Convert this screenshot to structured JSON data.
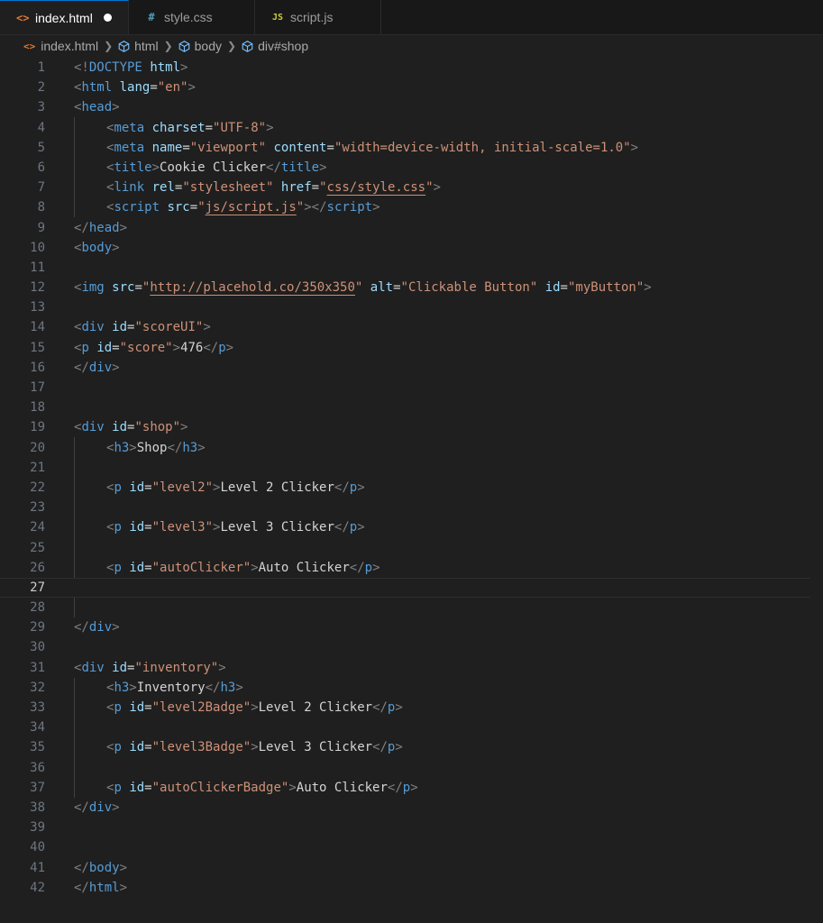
{
  "tabs": [
    {
      "icon": "<>",
      "label": "index.html",
      "active": true,
      "modified": true,
      "icon_color": "#e37933"
    },
    {
      "icon": "#",
      "label": "style.css",
      "active": false,
      "modified": false,
      "icon_color": "#519aba"
    },
    {
      "icon": "JS",
      "label": "script.js",
      "active": false,
      "modified": false,
      "icon_color": "#cbcb41"
    }
  ],
  "breadcrumb": {
    "file": "index.html",
    "items": [
      "html",
      "body",
      "div#shop"
    ]
  },
  "editor": {
    "current_line": 27,
    "lines": [
      {
        "n": "1",
        "indent": 0,
        "tokens": [
          [
            "br",
            "<!"
          ],
          [
            "tag",
            "DOCTYPE"
          ],
          [
            "txt",
            " "
          ],
          [
            "attr",
            "html"
          ],
          [
            "br",
            ">"
          ]
        ]
      },
      {
        "n": "2",
        "indent": 0,
        "tokens": [
          [
            "br",
            "<"
          ],
          [
            "tag",
            "html"
          ],
          [
            "txt",
            " "
          ],
          [
            "attr",
            "lang"
          ],
          [
            "txt",
            "="
          ],
          [
            "str",
            "\"en\""
          ],
          [
            "br",
            ">"
          ]
        ]
      },
      {
        "n": "3",
        "indent": 0,
        "tokens": [
          [
            "br",
            "<"
          ],
          [
            "tag",
            "head"
          ],
          [
            "br",
            ">"
          ]
        ]
      },
      {
        "n": "4",
        "indent": 1,
        "tokens": [
          [
            "br",
            "<"
          ],
          [
            "tag",
            "meta"
          ],
          [
            "txt",
            " "
          ],
          [
            "attr",
            "charset"
          ],
          [
            "txt",
            "="
          ],
          [
            "str",
            "\"UTF-8\""
          ],
          [
            "br",
            ">"
          ]
        ]
      },
      {
        "n": "5",
        "indent": 1,
        "tokens": [
          [
            "br",
            "<"
          ],
          [
            "tag",
            "meta"
          ],
          [
            "txt",
            " "
          ],
          [
            "attr",
            "name"
          ],
          [
            "txt",
            "="
          ],
          [
            "str",
            "\"viewport\""
          ],
          [
            "txt",
            " "
          ],
          [
            "attr",
            "content"
          ],
          [
            "txt",
            "="
          ],
          [
            "str",
            "\"width=device-width, initial-scale=1.0\""
          ],
          [
            "br",
            ">"
          ]
        ]
      },
      {
        "n": "6",
        "indent": 1,
        "tokens": [
          [
            "br",
            "<"
          ],
          [
            "tag",
            "title"
          ],
          [
            "br",
            ">"
          ],
          [
            "txt",
            "Cookie Clicker"
          ],
          [
            "br",
            "</"
          ],
          [
            "tag",
            "title"
          ],
          [
            "br",
            ">"
          ]
        ]
      },
      {
        "n": "7",
        "indent": 1,
        "tokens": [
          [
            "br",
            "<"
          ],
          [
            "tag",
            "link"
          ],
          [
            "txt",
            " "
          ],
          [
            "attr",
            "rel"
          ],
          [
            "txt",
            "="
          ],
          [
            "str",
            "\"stylesheet\""
          ],
          [
            "txt",
            " "
          ],
          [
            "attr",
            "href"
          ],
          [
            "txt",
            "="
          ],
          [
            "str",
            "\""
          ],
          [
            "link",
            "css/style.css"
          ],
          [
            "str",
            "\""
          ],
          [
            "br",
            ">"
          ]
        ]
      },
      {
        "n": "8",
        "indent": 1,
        "tokens": [
          [
            "br",
            "<"
          ],
          [
            "tag",
            "script"
          ],
          [
            "txt",
            " "
          ],
          [
            "attr",
            "src"
          ],
          [
            "txt",
            "="
          ],
          [
            "str",
            "\""
          ],
          [
            "link",
            "js/script.js"
          ],
          [
            "str",
            "\""
          ],
          [
            "br",
            "></"
          ],
          [
            "tag",
            "script"
          ],
          [
            "br",
            ">"
          ]
        ]
      },
      {
        "n": "9",
        "indent": 0,
        "tokens": [
          [
            "br",
            "</"
          ],
          [
            "tag",
            "head"
          ],
          [
            "br",
            ">"
          ]
        ]
      },
      {
        "n": "10",
        "indent": 0,
        "tokens": [
          [
            "br",
            "<"
          ],
          [
            "tag",
            "body"
          ],
          [
            "br",
            ">"
          ]
        ]
      },
      {
        "n": "11",
        "indent": 0,
        "tokens": []
      },
      {
        "n": "12",
        "indent": 0,
        "tokens": [
          [
            "br",
            "<"
          ],
          [
            "tag",
            "img"
          ],
          [
            "txt",
            " "
          ],
          [
            "attr",
            "src"
          ],
          [
            "txt",
            "="
          ],
          [
            "str",
            "\""
          ],
          [
            "link",
            "http://placehold.co/350x350"
          ],
          [
            "str",
            "\""
          ],
          [
            "txt",
            " "
          ],
          [
            "attr",
            "alt"
          ],
          [
            "txt",
            "="
          ],
          [
            "str",
            "\"Clickable Button\""
          ],
          [
            "txt",
            " "
          ],
          [
            "attr",
            "id"
          ],
          [
            "txt",
            "="
          ],
          [
            "str",
            "\"myButton\""
          ],
          [
            "br",
            ">"
          ]
        ]
      },
      {
        "n": "13",
        "indent": 0,
        "tokens": []
      },
      {
        "n": "14",
        "indent": 0,
        "tokens": [
          [
            "br",
            "<"
          ],
          [
            "tag",
            "div"
          ],
          [
            "txt",
            " "
          ],
          [
            "attr",
            "id"
          ],
          [
            "txt",
            "="
          ],
          [
            "str",
            "\"scoreUI\""
          ],
          [
            "br",
            ">"
          ]
        ]
      },
      {
        "n": "15",
        "indent": 0,
        "tokens": [
          [
            "br",
            "<"
          ],
          [
            "tag",
            "p"
          ],
          [
            "txt",
            " "
          ],
          [
            "attr",
            "id"
          ],
          [
            "txt",
            "="
          ],
          [
            "str",
            "\"score\""
          ],
          [
            "br",
            ">"
          ],
          [
            "txt",
            "476"
          ],
          [
            "br",
            "</"
          ],
          [
            "tag",
            "p"
          ],
          [
            "br",
            ">"
          ]
        ]
      },
      {
        "n": "16",
        "indent": 0,
        "tokens": [
          [
            "br",
            "</"
          ],
          [
            "tag",
            "div"
          ],
          [
            "br",
            ">"
          ]
        ]
      },
      {
        "n": "17",
        "indent": 0,
        "tokens": []
      },
      {
        "n": "18",
        "indent": 0,
        "tokens": []
      },
      {
        "n": "19",
        "indent": 0,
        "tokens": [
          [
            "br",
            "<"
          ],
          [
            "tag",
            "div"
          ],
          [
            "txt",
            " "
          ],
          [
            "attr",
            "id"
          ],
          [
            "txt",
            "="
          ],
          [
            "str",
            "\"shop\""
          ],
          [
            "br",
            ">"
          ]
        ]
      },
      {
        "n": "20",
        "indent": 1,
        "tokens": [
          [
            "br",
            "<"
          ],
          [
            "tag",
            "h3"
          ],
          [
            "br",
            ">"
          ],
          [
            "txt",
            "Shop"
          ],
          [
            "br",
            "</"
          ],
          [
            "tag",
            "h3"
          ],
          [
            "br",
            ">"
          ]
        ]
      },
      {
        "n": "21",
        "indent": 0,
        "tokens": []
      },
      {
        "n": "22",
        "indent": 1,
        "tokens": [
          [
            "br",
            "<"
          ],
          [
            "tag",
            "p"
          ],
          [
            "txt",
            " "
          ],
          [
            "attr",
            "id"
          ],
          [
            "txt",
            "="
          ],
          [
            "str",
            "\"level2\""
          ],
          [
            "br",
            ">"
          ],
          [
            "txt",
            "Level 2 Clicker"
          ],
          [
            "br",
            "</"
          ],
          [
            "tag",
            "p"
          ],
          [
            "br",
            ">"
          ]
        ]
      },
      {
        "n": "23",
        "indent": 0,
        "tokens": []
      },
      {
        "n": "24",
        "indent": 1,
        "tokens": [
          [
            "br",
            "<"
          ],
          [
            "tag",
            "p"
          ],
          [
            "txt",
            " "
          ],
          [
            "attr",
            "id"
          ],
          [
            "txt",
            "="
          ],
          [
            "str",
            "\"level3\""
          ],
          [
            "br",
            ">"
          ],
          [
            "txt",
            "Level 3 Clicker"
          ],
          [
            "br",
            "</"
          ],
          [
            "tag",
            "p"
          ],
          [
            "br",
            ">"
          ]
        ]
      },
      {
        "n": "25",
        "indent": 0,
        "tokens": []
      },
      {
        "n": "26",
        "indent": 1,
        "tokens": [
          [
            "br",
            "<"
          ],
          [
            "tag",
            "p"
          ],
          [
            "txt",
            " "
          ],
          [
            "attr",
            "id"
          ],
          [
            "txt",
            "="
          ],
          [
            "str",
            "\"autoClicker\""
          ],
          [
            "br",
            ">"
          ],
          [
            "txt",
            "Auto Clicker"
          ],
          [
            "br",
            "</"
          ],
          [
            "tag",
            "p"
          ],
          [
            "br",
            ">"
          ]
        ]
      },
      {
        "n": "27",
        "indent": 0,
        "tokens": []
      },
      {
        "n": "28",
        "indent": 0,
        "tokens": []
      },
      {
        "n": "29",
        "indent": 0,
        "tokens": [
          [
            "br",
            "</"
          ],
          [
            "tag",
            "div"
          ],
          [
            "br",
            ">"
          ]
        ]
      },
      {
        "n": "30",
        "indent": 0,
        "tokens": []
      },
      {
        "n": "31",
        "indent": 0,
        "tokens": [
          [
            "br",
            "<"
          ],
          [
            "tag",
            "div"
          ],
          [
            "txt",
            " "
          ],
          [
            "attr",
            "id"
          ],
          [
            "txt",
            "="
          ],
          [
            "str",
            "\"inventory\""
          ],
          [
            "br",
            ">"
          ]
        ]
      },
      {
        "n": "32",
        "indent": 1,
        "tokens": [
          [
            "br",
            "<"
          ],
          [
            "tag",
            "h3"
          ],
          [
            "br",
            ">"
          ],
          [
            "txt",
            "Inventory"
          ],
          [
            "br",
            "</"
          ],
          [
            "tag",
            "h3"
          ],
          [
            "br",
            ">"
          ]
        ]
      },
      {
        "n": "33",
        "indent": 1,
        "tokens": [
          [
            "br",
            "<"
          ],
          [
            "tag",
            "p"
          ],
          [
            "txt",
            " "
          ],
          [
            "attr",
            "id"
          ],
          [
            "txt",
            "="
          ],
          [
            "str",
            "\"level2Badge\""
          ],
          [
            "br",
            ">"
          ],
          [
            "txt",
            "Level 2 Clicker"
          ],
          [
            "br",
            "</"
          ],
          [
            "tag",
            "p"
          ],
          [
            "br",
            ">"
          ]
        ]
      },
      {
        "n": "34",
        "indent": 0,
        "tokens": []
      },
      {
        "n": "35",
        "indent": 1,
        "tokens": [
          [
            "br",
            "<"
          ],
          [
            "tag",
            "p"
          ],
          [
            "txt",
            " "
          ],
          [
            "attr",
            "id"
          ],
          [
            "txt",
            "="
          ],
          [
            "str",
            "\"level3Badge\""
          ],
          [
            "br",
            ">"
          ],
          [
            "txt",
            "Level 3 Clicker"
          ],
          [
            "br",
            "</"
          ],
          [
            "tag",
            "p"
          ],
          [
            "br",
            ">"
          ]
        ]
      },
      {
        "n": "36",
        "indent": 0,
        "tokens": []
      },
      {
        "n": "37",
        "indent": 1,
        "tokens": [
          [
            "br",
            "<"
          ],
          [
            "tag",
            "p"
          ],
          [
            "txt",
            " "
          ],
          [
            "attr",
            "id"
          ],
          [
            "txt",
            "="
          ],
          [
            "str",
            "\"autoClickerBadge\""
          ],
          [
            "br",
            ">"
          ],
          [
            "txt",
            "Auto Clicker"
          ],
          [
            "br",
            "</"
          ],
          [
            "tag",
            "p"
          ],
          [
            "br",
            ">"
          ]
        ]
      },
      {
        "n": "38",
        "indent": 0,
        "tokens": [
          [
            "br",
            "</"
          ],
          [
            "tag",
            "div"
          ],
          [
            "br",
            ">"
          ]
        ]
      },
      {
        "n": "39",
        "indent": 0,
        "tokens": []
      },
      {
        "n": "40",
        "indent": 0,
        "tokens": []
      },
      {
        "n": "41",
        "indent": 0,
        "tokens": [
          [
            "br",
            "</"
          ],
          [
            "tag",
            "body"
          ],
          [
            "br",
            ">"
          ]
        ]
      },
      {
        "n": "42",
        "indent": 0,
        "tokens": [
          [
            "br",
            "</"
          ],
          [
            "tag",
            "html"
          ],
          [
            "br",
            ">"
          ]
        ]
      }
    ]
  }
}
